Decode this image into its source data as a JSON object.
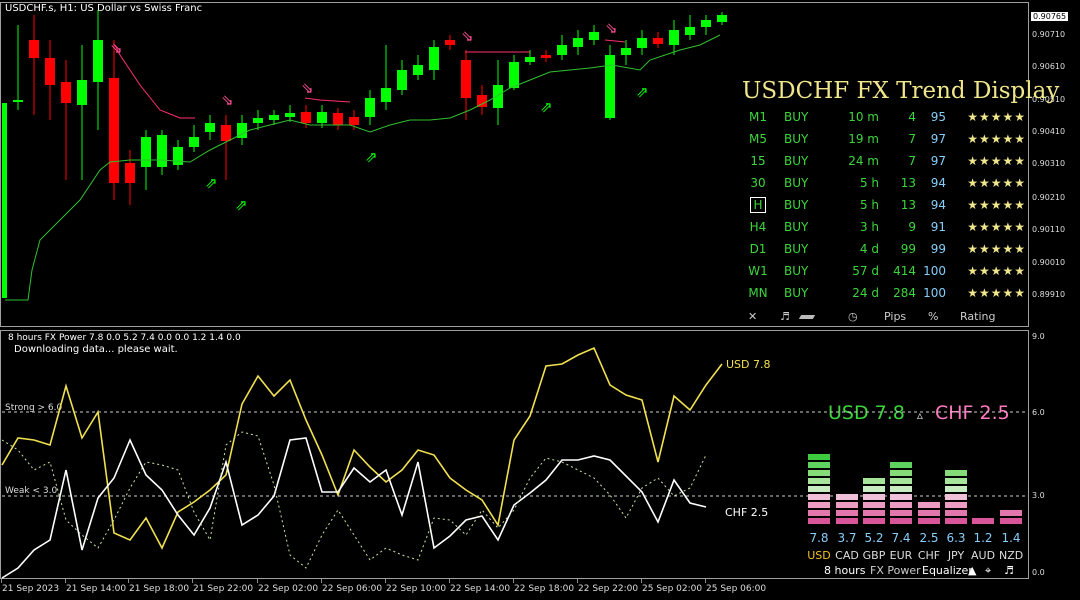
{
  "main_chart": {
    "title": "USDCHF.s, H1:  US Dollar vs Swiss Franc",
    "price_axis": [
      "0.90765",
      "0.90710",
      "0.90610",
      "0.90510",
      "0.90410",
      "0.90310",
      "0.90210",
      "0.90110",
      "0.90010",
      "0.89910"
    ],
    "current_price": "0.90765"
  },
  "trend_display": {
    "title": "USDCHF FX Trend Display",
    "rows": [
      {
        "tf": "M1",
        "signal": "BUY",
        "duration": "10 m",
        "pips": "4",
        "pct": "95",
        "stars": "★★★★★"
      },
      {
        "tf": "M5",
        "signal": "BUY",
        "duration": "19 m",
        "pips": "7",
        "pct": "97",
        "stars": "★★★★★"
      },
      {
        "tf": "15",
        "signal": "BUY",
        "duration": "24 m",
        "pips": "7",
        "pct": "97",
        "stars": "★★★★★"
      },
      {
        "tf": "30",
        "signal": "BUY",
        "duration": "5 h",
        "pips": "13",
        "pct": "94",
        "stars": "★★★★★"
      },
      {
        "tf": "H",
        "signal": "BUY",
        "duration": "5 h",
        "pips": "13",
        "pct": "94",
        "stars": "★★★★★"
      },
      {
        "tf": "H4",
        "signal": "BUY",
        "duration": "3 h",
        "pips": "9",
        "pct": "91",
        "stars": "★★★★★"
      },
      {
        "tf": "D1",
        "signal": "BUY",
        "duration": "4 d",
        "pips": "99",
        "pct": "99",
        "stars": "★★★★★"
      },
      {
        "tf": "W1",
        "signal": "BUY",
        "duration": "57 d",
        "pips": "414",
        "pct": "100",
        "stars": "★★★★★"
      },
      {
        "tf": "MN",
        "signal": "BUY",
        "duration": "24 d",
        "pips": "284",
        "pct": "100",
        "stars": "★★★★★"
      }
    ],
    "footer": {
      "close": "✕",
      "music": "♬",
      "pips": "Pips",
      "pct": "%",
      "rating": "Rating"
    }
  },
  "indicator": {
    "title": "8 hours FX Power 7.8 0.0 5.2 7.4 0.0 0.0 1.2 1.4 0.0",
    "message": "Downloading data... please wait.",
    "strong_label": "Strong > 6.0",
    "weak_label": "Weak < 3.0",
    "usd_label": "USD 7.8",
    "chf_label": "CHF 2.5",
    "axis": [
      "9.0",
      "6.0",
      "3.0",
      "0.0"
    ],
    "headline_usd": "USD 7.8",
    "headline_sep": "▵",
    "headline_chf": "CHF 2.5",
    "currencies": [
      {
        "name": "USD",
        "value": "7.8"
      },
      {
        "name": "CAD",
        "value": "3.7"
      },
      {
        "name": "GBP",
        "value": "5.2"
      },
      {
        "name": "EUR",
        "value": "7.4"
      },
      {
        "name": "CHF",
        "value": "2.5"
      },
      {
        "name": "JPY",
        "value": "6.3"
      },
      {
        "name": "AUD",
        "value": "1.2"
      },
      {
        "name": "NZD",
        "value": "1.4"
      }
    ],
    "eq_footer": {
      "hours": "8 hours",
      "power": "FX Power",
      "equalizer": "Equalizer"
    }
  },
  "time_axis": [
    "21 Sep 2023",
    "21 Sep 14:00",
    "21 Sep 18:00",
    "21 Sep 22:00",
    "22 Sep 02:00",
    "22 Sep 06:00",
    "22 Sep 10:00",
    "22 Sep 14:00",
    "22 Sep 18:00",
    "22 Sep 22:00",
    "25 Sep 02:00",
    "25 Sep 06:00"
  ],
  "colors": {
    "bull": "#00ff00",
    "bear": "#ff0000",
    "usd_line": "#f0e050",
    "chf_line": "#ffffff",
    "buy_arrow": "#00ff00",
    "sell_arrow": "#ff4f9a",
    "headline_usd": "#3cd63c",
    "headline_chf": "#ff79c0"
  }
}
